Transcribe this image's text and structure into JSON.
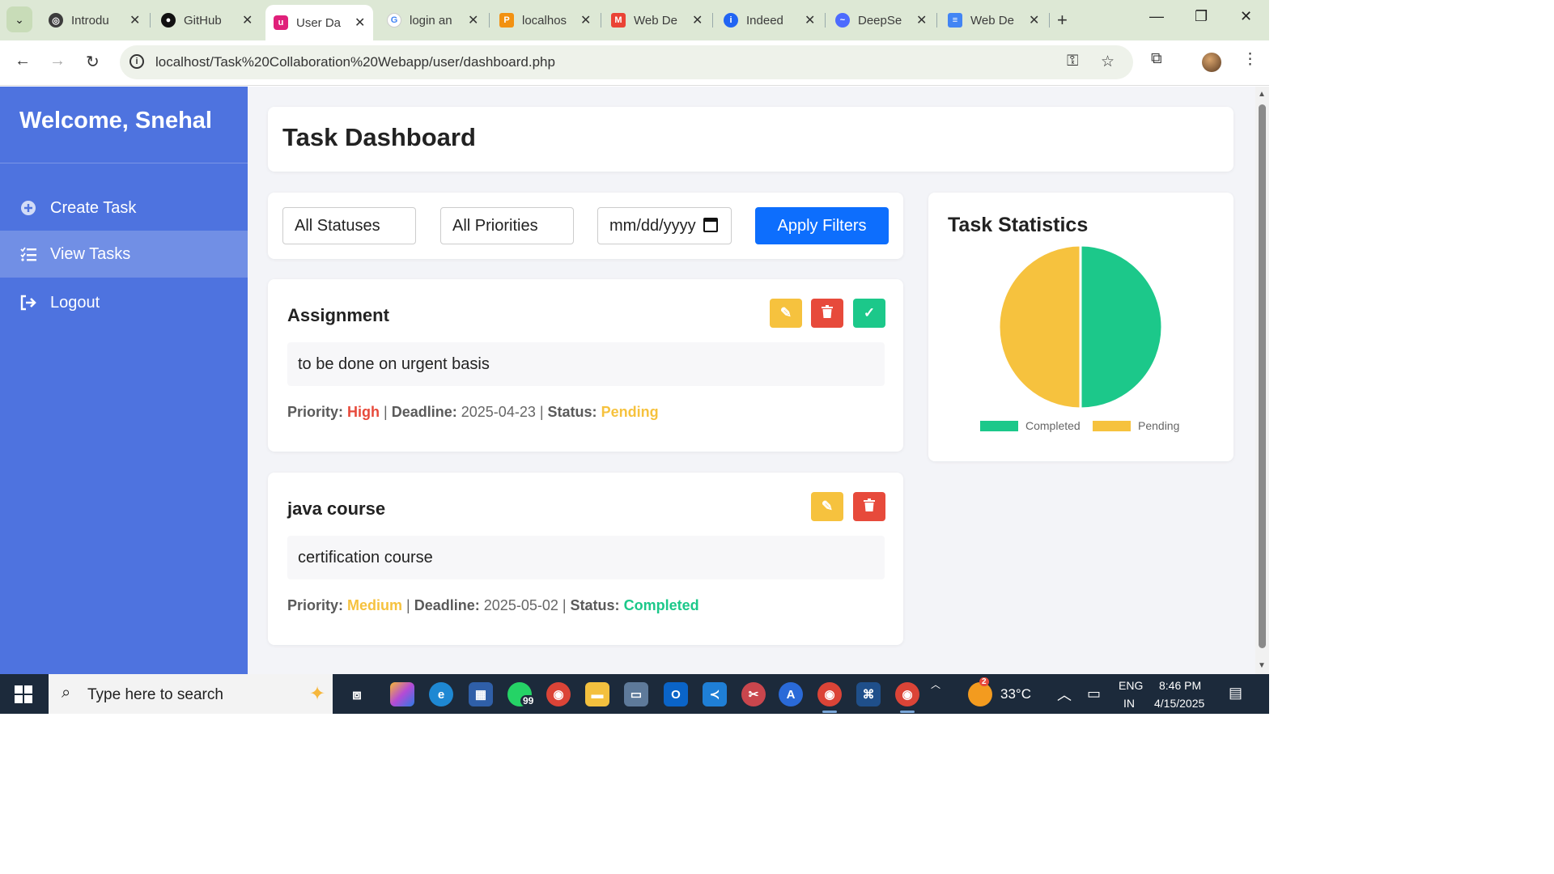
{
  "browser": {
    "tabs": [
      {
        "label": "Introdu",
        "icon": "openai-icon",
        "color": "#3c3c3c"
      },
      {
        "label": "GitHub",
        "icon": "github-icon",
        "color": "#111111"
      },
      {
        "label": "User Da",
        "icon": "app-icon",
        "color": "#e0207a"
      },
      {
        "label": "login an",
        "icon": "google-icon",
        "color": "#4285f4"
      },
      {
        "label": "localhos",
        "icon": "phpmyadmin-icon",
        "color": "#f29111"
      },
      {
        "label": "Web De",
        "icon": "gmail-icon",
        "color": "#ea4335"
      },
      {
        "label": "Indeed",
        "icon": "indeed-icon",
        "color": "#2164f3"
      },
      {
        "label": "DeepSe",
        "icon": "deepseek-icon",
        "color": "#4d6bfe"
      },
      {
        "label": "Web De",
        "icon": "docs-icon",
        "color": "#4285f4"
      }
    ],
    "url": "localhost/Task%20Collaboration%20Webapp/user/dashboard.php"
  },
  "sidebar": {
    "welcome": "Welcome, Snehal",
    "items": [
      {
        "label": "Create Task"
      },
      {
        "label": "View Tasks"
      },
      {
        "label": "Logout"
      }
    ]
  },
  "header": {
    "title": "Task Dashboard"
  },
  "filters": {
    "status": "All Statuses",
    "priority": "All Priorities",
    "date_placeholder": "mm/dd/yyyy",
    "apply_label": "Apply Filters"
  },
  "tasks": [
    {
      "title": "Assignment",
      "description": "to be done on urgent basis",
      "priority_label": "Priority:",
      "priority": "High",
      "deadline_label": "Deadline:",
      "deadline": "2025-04-23",
      "status_label": "Status:",
      "status": "Pending"
    },
    {
      "title": "java course",
      "description": "certification course",
      "priority_label": "Priority:",
      "priority": "Medium",
      "deadline_label": "Deadline:",
      "deadline": "2025-05-02",
      "status_label": "Status:",
      "status": "Completed"
    }
  ],
  "stats": {
    "title": "Task Statistics"
  },
  "chart_data": {
    "type": "pie",
    "categories": [
      "Completed",
      "Pending"
    ],
    "values": [
      1,
      1
    ],
    "colors": [
      "#1cc88a",
      "#f6c23e"
    ],
    "legend_position": "bottom"
  },
  "taskbar": {
    "search_placeholder": "Type here to search",
    "whatsapp_badge": "99",
    "weather_badge": "2",
    "temperature": "33°C",
    "lang_line1": "ENG",
    "lang_line2": "IN",
    "time": "8:46 PM",
    "date": "4/15/2025"
  },
  "colors": {
    "sidebar": "#4e73df",
    "primary": "#0d6efd",
    "warning": "#f6c23e",
    "danger": "#e74a3b",
    "success": "#1cc88a"
  }
}
